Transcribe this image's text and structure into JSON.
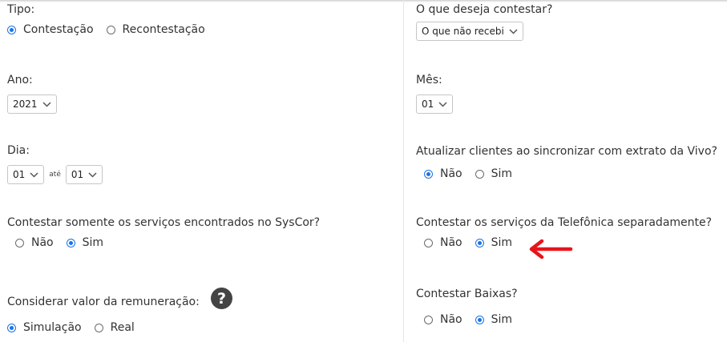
{
  "left": {
    "tipo": {
      "label": "Tipo:",
      "options": [
        {
          "label": "Contestação",
          "checked": true
        },
        {
          "label": "Recontestação",
          "checked": false
        }
      ]
    },
    "ano": {
      "label": "Ano:",
      "value": "2021"
    },
    "dia": {
      "label": "Dia:",
      "from": "01",
      "separator": "até",
      "to": "01"
    },
    "syscor": {
      "label": "Contestar somente os serviços encontrados no SysCor?",
      "options": [
        {
          "label": "Não",
          "checked": false
        },
        {
          "label": "Sim",
          "checked": true
        }
      ]
    },
    "remuneracao": {
      "label": "Considerar valor da remuneração:",
      "help_icon": "question-circle-icon",
      "options": [
        {
          "label": "Simulação",
          "checked": true
        },
        {
          "label": "Real",
          "checked": false
        }
      ]
    }
  },
  "right": {
    "contestar": {
      "label": "O que deseja contestar?",
      "value": "O que não recebi"
    },
    "mes": {
      "label": "Mês:",
      "value": "01"
    },
    "atualizar": {
      "label": "Atualizar clientes ao sincronizar com extrato da Vivo?",
      "options": [
        {
          "label": "Não",
          "checked": true
        },
        {
          "label": "Sim",
          "checked": false
        }
      ]
    },
    "telefonica": {
      "label": "Contestar os serviços da Telefônica separadamente?",
      "options": [
        {
          "label": "Não",
          "checked": false
        },
        {
          "label": "Sim",
          "checked": true
        }
      ]
    },
    "baixas": {
      "label": "Contestar Baixas?",
      "options": [
        {
          "label": "Não",
          "checked": false
        },
        {
          "label": "Sim",
          "checked": true
        }
      ]
    }
  },
  "annotation": {
    "icon": "red-arrow-icon",
    "color": "#e8141c"
  },
  "colors": {
    "accent": "#1a73e8"
  }
}
